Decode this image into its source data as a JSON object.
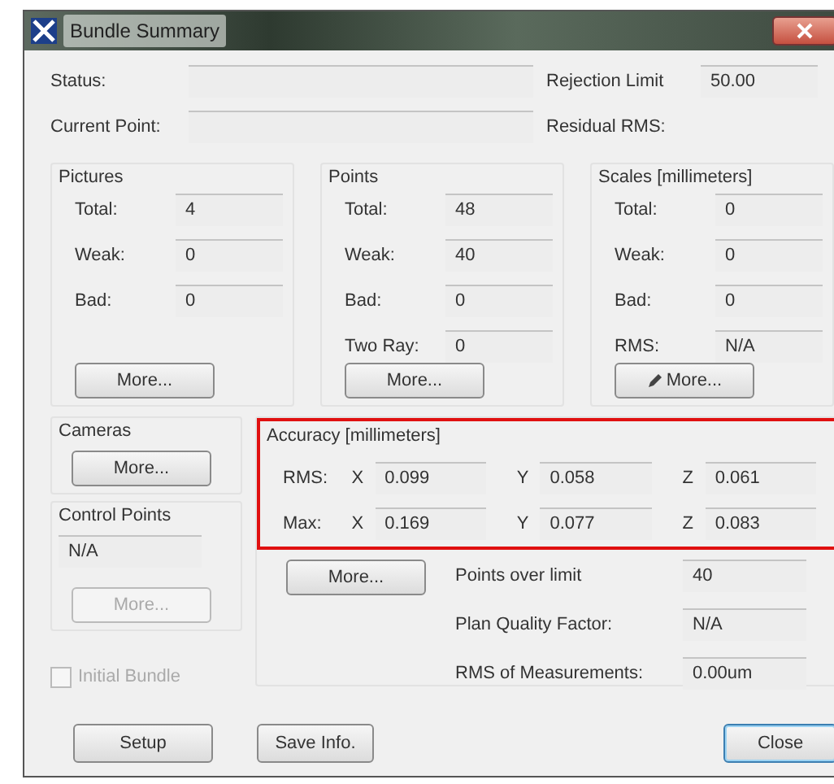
{
  "window": {
    "title": "Bundle Summary"
  },
  "status_rows": [
    {
      "label": "Status:",
      "right_label": "Rejection Limit",
      "right_value": "50.00"
    },
    {
      "label": "Current Point:",
      "right_label": "Residual RMS:"
    }
  ],
  "groups": [
    {
      "title": "Pictures",
      "rows": [
        {
          "label": "Total:",
          "value": "4"
        },
        {
          "label": "Weak:",
          "value": "0"
        },
        {
          "label": "Bad:",
          "value": "0"
        }
      ],
      "button": {
        "label": "More...",
        "disabled": false,
        "icon": false
      }
    },
    {
      "title": "Points",
      "rows": [
        {
          "label": "Total:",
          "value": "48"
        },
        {
          "label": "Weak:",
          "value": "40"
        },
        {
          "label": "Bad:",
          "value": "0"
        },
        {
          "label": "Two Ray:",
          "value": "0"
        }
      ],
      "button": {
        "label": "More...",
        "disabled": false,
        "icon": false
      }
    },
    {
      "title": "Scales [millimeters]",
      "rows": [
        {
          "label": "Total:",
          "value": "0"
        },
        {
          "label": "Weak:",
          "value": "0"
        },
        {
          "label": "Bad:",
          "value": "0"
        },
        {
          "label": "RMS:",
          "value": "N/A"
        }
      ],
      "button": {
        "label": "More...",
        "disabled": false,
        "icon": true
      }
    }
  ],
  "cameras": {
    "title": "Cameras",
    "button": {
      "label": "More...",
      "disabled": false
    }
  },
  "control_points": {
    "title": "Control Points",
    "value": "N/A",
    "button": {
      "label": "More...",
      "disabled": true
    }
  },
  "accuracy": {
    "title": "Accuracy [millimeters]",
    "highlighted": true,
    "rows": [
      {
        "label": "RMS:",
        "axes": [
          {
            "axis": "X",
            "value": "0.099"
          },
          {
            "axis": "Y",
            "value": "0.058"
          },
          {
            "axis": "Z",
            "value": "0.061"
          }
        ]
      },
      {
        "label": "Max:",
        "axes": [
          {
            "axis": "X",
            "value": "0.169"
          },
          {
            "axis": "Y",
            "value": "0.077"
          },
          {
            "axis": "Z",
            "value": "0.083"
          }
        ]
      }
    ],
    "button": {
      "label": "More...",
      "disabled": false
    },
    "stats": [
      {
        "label": "Points over limit",
        "value": "40"
      },
      {
        "label": "Plan Quality Factor:",
        "value": "N/A"
      },
      {
        "label": "RMS of Measurements:",
        "value": "0.00um"
      }
    ]
  },
  "initial_bundle": {
    "label": "Initial Bundle",
    "checked": false,
    "disabled": true
  },
  "buttons": [
    {
      "label": "Setup",
      "default": false
    },
    {
      "label": "Save Info.",
      "default": false
    },
    {
      "label": "Close",
      "default": true
    }
  ]
}
